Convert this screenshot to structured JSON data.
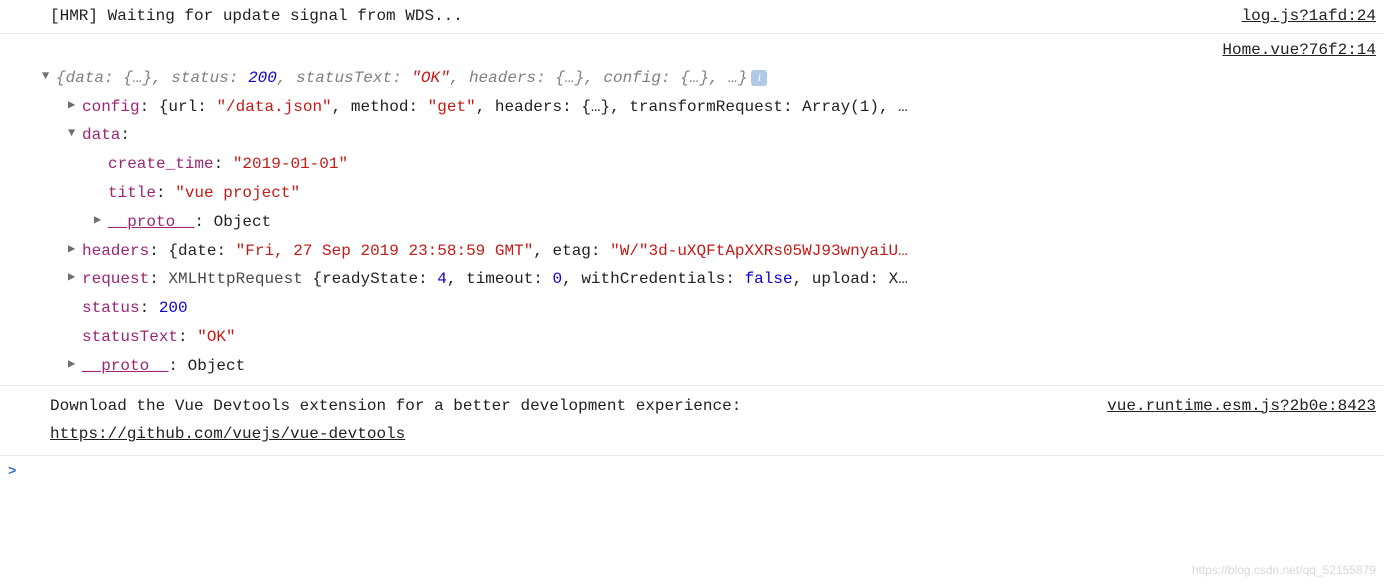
{
  "hmr": {
    "message": "[HMR] Waiting for update signal from WDS...",
    "source": "log.js?1afd:24"
  },
  "objSource": "Home.vue?76f2:14",
  "preview": {
    "open": "{",
    "data_key": "data:",
    "data_val": "{…}",
    "c1": ", ",
    "status_key": "status:",
    "status_val": "200",
    "c2": ", ",
    "statusText_key": "statusText:",
    "statusText_val": "\"OK\"",
    "c3": ", ",
    "headers_key": "headers:",
    "headers_val": "{…}",
    "c4": ", ",
    "config_key": "config:",
    "config_val": "{…}",
    "c5": ", …}"
  },
  "config": {
    "key": "config",
    "colon": ": ",
    "open": "{",
    "url_k": "url: ",
    "url_v": "\"/data.json\"",
    "c1": ", ",
    "method_k": "method: ",
    "method_v": "\"get\"",
    "c2": ", ",
    "headers_k": "headers: ",
    "headers_v": "{…}",
    "c3": ", ",
    "tr_k": "transformRequest: ",
    "tr_v": "Array(1)",
    "tail": ", …"
  },
  "dataNode": {
    "key": "data",
    "colon": ":",
    "create_time_k": "create_time",
    "create_time_colon": ": ",
    "create_time_v": "\"2019-01-01\"",
    "title_k": "title",
    "title_colon": ": ",
    "title_v": "\"vue project\"",
    "proto_k": "__proto__",
    "proto_colon": ": ",
    "proto_v": "Object"
  },
  "headers": {
    "key": "headers",
    "colon": ": ",
    "open": "{",
    "date_k": "date: ",
    "date_v": "\"Fri, 27 Sep 2019 23:58:59 GMT\"",
    "c1": ", ",
    "etag_k": "etag: ",
    "etag_v": "\"W/\"3d-uXQFtApXXRs05WJ93wnyaiU…"
  },
  "request": {
    "key": "request",
    "colon": ": ",
    "type": "XMLHttpRequest ",
    "open": "{",
    "rs_k": "readyState: ",
    "rs_v": "4",
    "c1": ", ",
    "to_k": "timeout: ",
    "to_v": "0",
    "c2": ", ",
    "wc_k": "withCredentials: ",
    "wc_v": "false",
    "c3": ", ",
    "up_k": "upload: ",
    "up_v": "X…"
  },
  "status": {
    "k": "status",
    "colon": ": ",
    "v": "200"
  },
  "statusText": {
    "k": "statusText",
    "colon": ": ",
    "v": "\"OK\""
  },
  "proto2": {
    "k": "__proto__",
    "colon": ": ",
    "v": "Object"
  },
  "devtools": {
    "text1": "Download the Vue Devtools extension for a better development experience:",
    "link": "https://github.com/vuejs/vue-devtools",
    "source": "vue.runtime.esm.js?2b0e:8423"
  },
  "prompt": ">",
  "watermark": "https://blog.csdn.net/qq_52155879",
  "infoGlyph": "i"
}
